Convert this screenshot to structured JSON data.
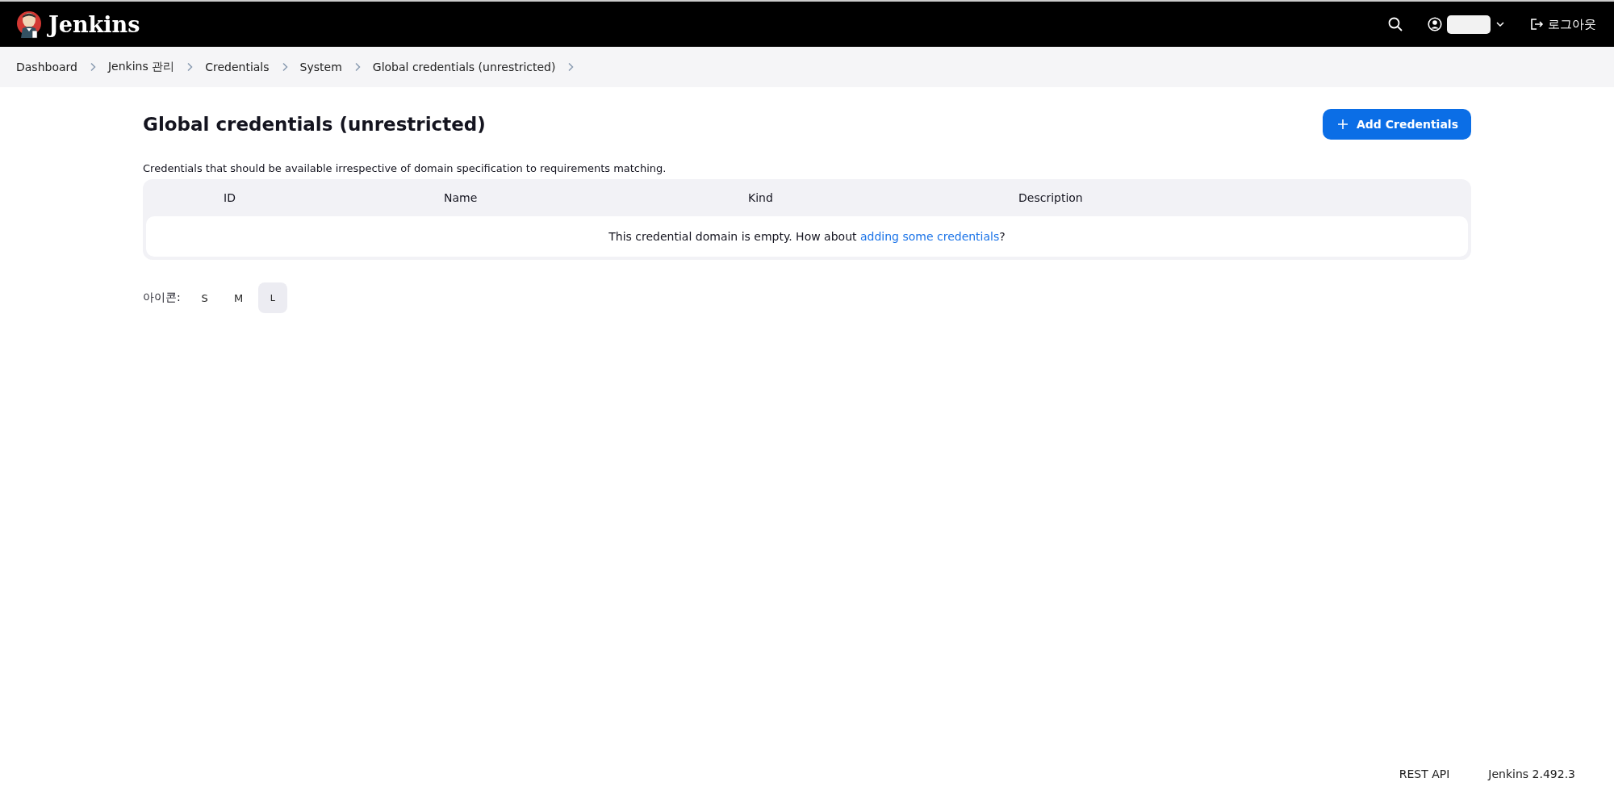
{
  "header": {
    "brand": "Jenkins",
    "logout": "로그아웃"
  },
  "breadcrumbs": [
    "Dashboard",
    "Jenkins 관리",
    "Credentials",
    "System",
    "Global credentials (unrestricted)"
  ],
  "page": {
    "title": "Global credentials (unrestricted)",
    "add_button": "Add Credentials",
    "description": "Credentials that should be available irrespective of domain specification to requirements matching."
  },
  "table": {
    "columns": [
      "ID",
      "Name",
      "Kind",
      "Description"
    ],
    "empty_message": {
      "before": "This credential domain is empty. How about ",
      "link": "adding some credentials",
      "after": "?"
    }
  },
  "icon_size": {
    "label": "아이콘:",
    "options": [
      {
        "label": "S",
        "selected": false
      },
      {
        "label": "M",
        "selected": false
      },
      {
        "label": "L",
        "selected": true
      }
    ]
  },
  "footer": {
    "links": [
      "REST API",
      "Jenkins 2.492.3"
    ]
  }
}
